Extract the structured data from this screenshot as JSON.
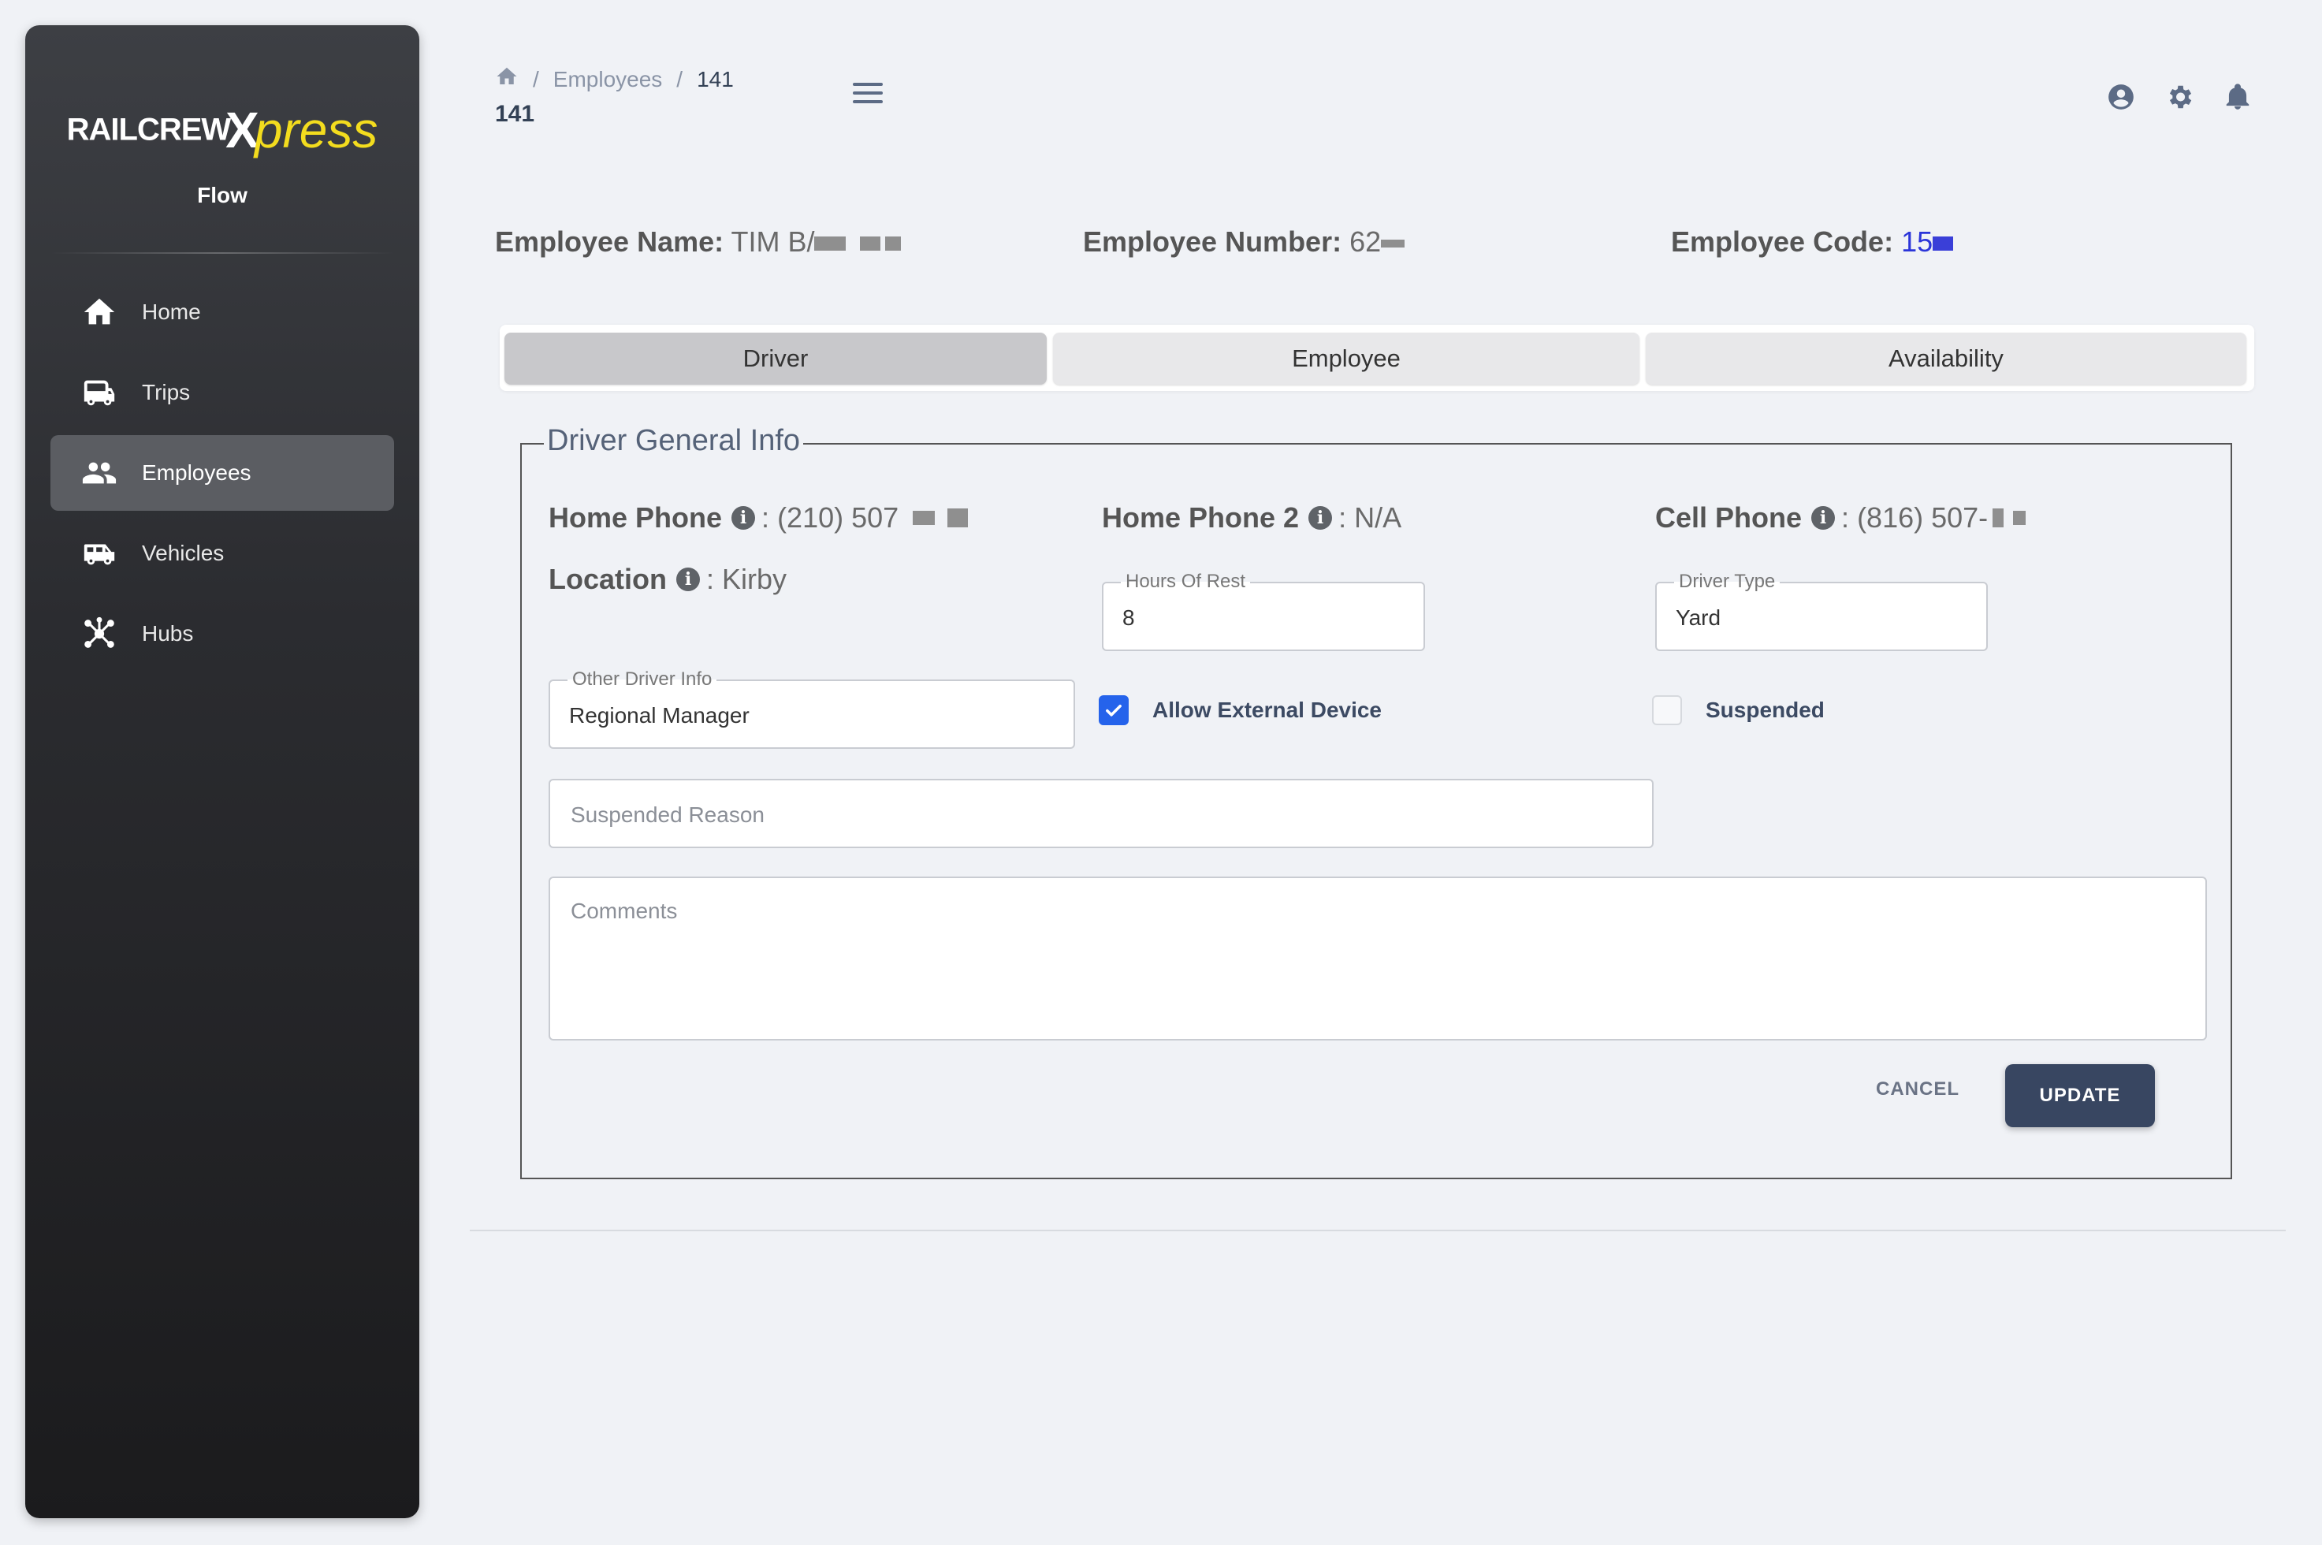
{
  "app": {
    "logo_rail": "RAILCREW",
    "logo_x": "X",
    "logo_press": "press",
    "product": "Flow"
  },
  "sidebar": {
    "items": [
      {
        "label": "Home",
        "icon": "home-icon"
      },
      {
        "label": "Trips",
        "icon": "bus-icon"
      },
      {
        "label": "Employees",
        "icon": "people-icon",
        "active": true
      },
      {
        "label": "Vehicles",
        "icon": "van-icon"
      },
      {
        "label": "Hubs",
        "icon": "hub-icon"
      }
    ]
  },
  "header": {
    "breadcrumb": [
      "Employees",
      "141"
    ],
    "title": "141",
    "icons": [
      "account-icon",
      "settings-icon",
      "notifications-icon"
    ]
  },
  "employee": {
    "name_label": "Employee Name:",
    "name_value": "TIM B/",
    "number_label": "Employee Number:",
    "number_value": "62",
    "code_label": "Employee Code:",
    "code_value": "15"
  },
  "tabs": [
    {
      "label": "Driver",
      "active": true
    },
    {
      "label": "Employee"
    },
    {
      "label": "Availability"
    }
  ],
  "driver_info": {
    "legend": "Driver General Info",
    "home_phone_label": "Home Phone",
    "home_phone_value": "(210) 507",
    "home_phone2_label": "Home Phone 2",
    "home_phone2_value": "N/A",
    "cell_phone_label": "Cell Phone",
    "cell_phone_value": "(816) 507-",
    "location_label": "Location",
    "location_value": "Kirby",
    "separator": ":",
    "hours_of_rest_label": "Hours Of Rest",
    "hours_of_rest_value": "8",
    "driver_type_label": "Driver Type",
    "driver_type_value": "Yard",
    "other_info_label": "Other Driver Info",
    "other_info_value": "Regional Manager",
    "allow_external_label": "Allow External Device",
    "allow_external_checked": true,
    "suspended_label": "Suspended",
    "suspended_checked": false,
    "suspended_reason_placeholder": "Suspended Reason",
    "comments_placeholder": "Comments"
  },
  "actions": {
    "cancel": "CANCEL",
    "update": "UPDATE"
  },
  "colors": {
    "accent": "#384661",
    "checkbox": "#2563eb",
    "code_link": "#2b35d9",
    "logo_yellow": "#f3dc1e"
  }
}
